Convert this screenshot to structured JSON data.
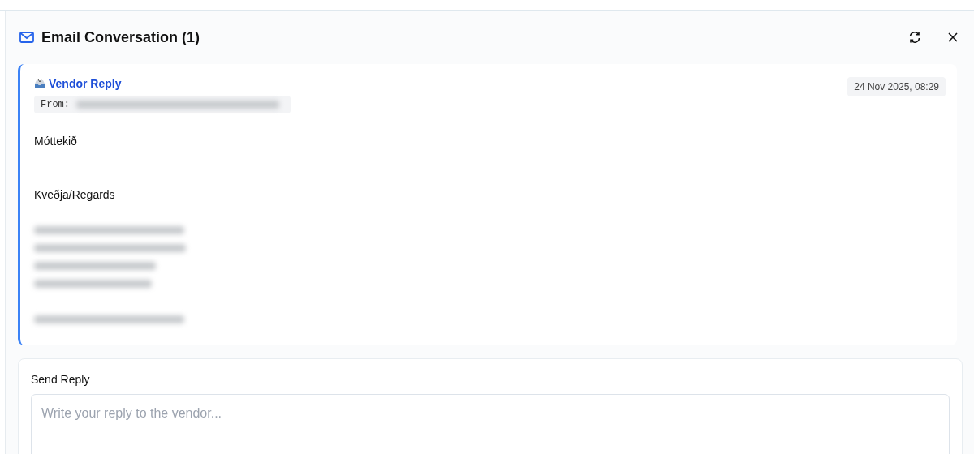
{
  "panel": {
    "title": "Email Conversation (1)"
  },
  "messages": [
    {
      "sender": "Vendor Reply",
      "from_label": "From:",
      "from_redacted": true,
      "date": "24 Nov 2025, 08:29",
      "body": [
        {
          "kind": "text",
          "text": "Móttekið"
        },
        {
          "kind": "blank"
        },
        {
          "kind": "blank"
        },
        {
          "kind": "text",
          "text": "Kveðja/Regards"
        },
        {
          "kind": "blank"
        },
        {
          "kind": "redacted"
        },
        {
          "kind": "redacted"
        },
        {
          "kind": "redacted"
        },
        {
          "kind": "redacted"
        },
        {
          "kind": "blank"
        },
        {
          "kind": "redacted"
        }
      ]
    }
  ],
  "reply": {
    "label": "Send Reply",
    "placeholder": "Write your reply to the vendor..."
  }
}
